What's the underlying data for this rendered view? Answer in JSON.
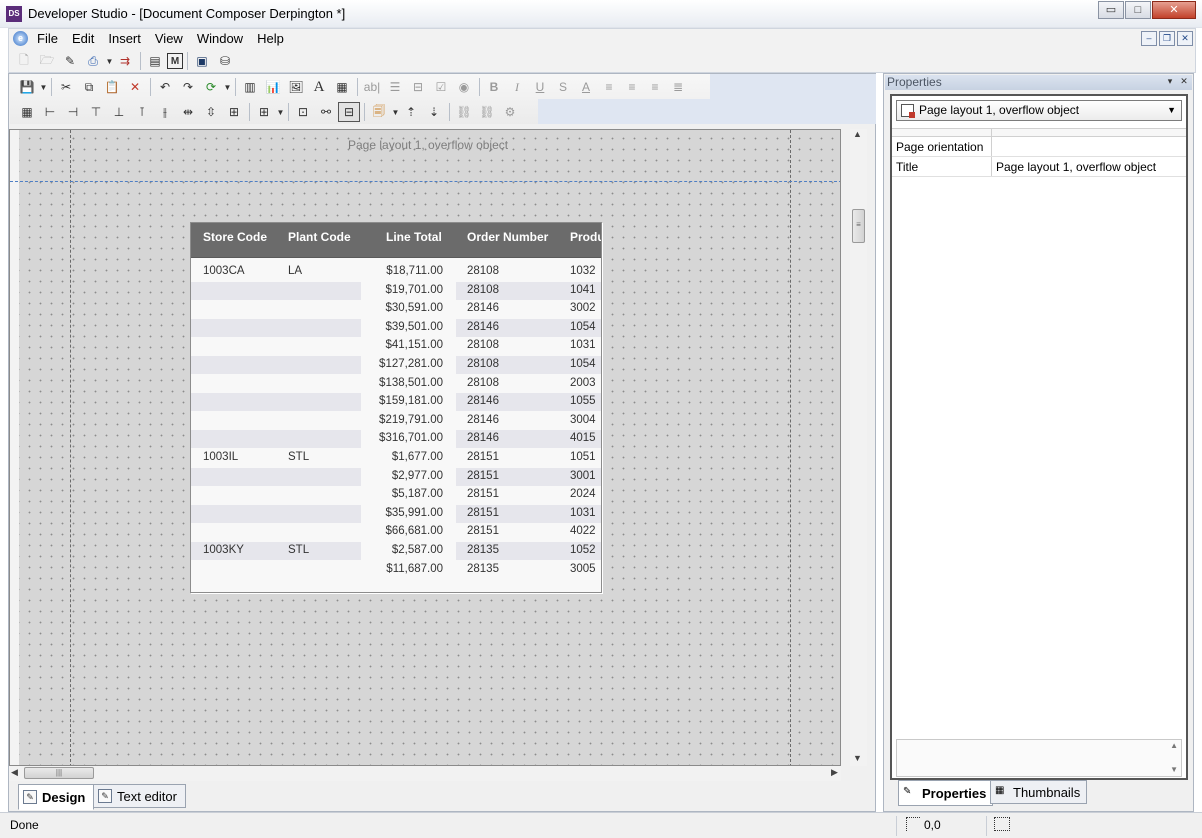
{
  "window": {
    "app_icon": "DS",
    "title": "Developer Studio - [Document Composer Derpington *]",
    "controls": {
      "minimize": "▭",
      "maximize": "□",
      "close": "✕"
    }
  },
  "menu": {
    "items": [
      "File",
      "Edit",
      "Insert",
      "View",
      "Window",
      "Help"
    ],
    "mdi_controls": {
      "minimize": "–",
      "restore": "❐",
      "close": "✕"
    }
  },
  "canvas": {
    "page_caption": "Page layout 1, overflow object"
  },
  "report_table": {
    "headers": [
      "Store Code",
      "Plant Code",
      "Line Total",
      "Order Number",
      "Produ"
    ],
    "rows": [
      [
        "1003CA",
        "LA",
        "$18,711.00",
        "28108",
        "1032"
      ],
      [
        "",
        "",
        "$19,701.00",
        "28108",
        "1041"
      ],
      [
        "",
        "",
        "$30,591.00",
        "28146",
        "3002"
      ],
      [
        "",
        "",
        "$39,501.00",
        "28146",
        "1054"
      ],
      [
        "",
        "",
        "$41,151.00",
        "28108",
        "1031"
      ],
      [
        "",
        "",
        "$127,281.00",
        "28108",
        "1054"
      ],
      [
        "",
        "",
        "$138,501.00",
        "28108",
        "2003"
      ],
      [
        "",
        "",
        "$159,181.00",
        "28146",
        "1055"
      ],
      [
        "",
        "",
        "$219,791.00",
        "28146",
        "3004"
      ],
      [
        "",
        "",
        "$316,701.00",
        "28146",
        "4015"
      ],
      [
        "1003IL",
        "STL",
        "$1,677.00",
        "28151",
        "1051"
      ],
      [
        "",
        "",
        "$2,977.00",
        "28151",
        "3001"
      ],
      [
        "",
        "",
        "$5,187.00",
        "28151",
        "2024"
      ],
      [
        "",
        "",
        "$35,991.00",
        "28151",
        "1031"
      ],
      [
        "",
        "",
        "$66,681.00",
        "28151",
        "4022"
      ],
      [
        "1003KY",
        "STL",
        "$2,587.00",
        "28135",
        "1052"
      ],
      [
        "",
        "",
        "$11,687.00",
        "28135",
        "3005"
      ]
    ]
  },
  "doc_tabs": {
    "design": "Design",
    "text_editor": "Text editor"
  },
  "properties": {
    "panel_title": "Properties",
    "selected_object": "Page layout 1, overflow object",
    "rows": [
      {
        "key": "Page orientation",
        "value": ""
      },
      {
        "key": "Title",
        "value": "Page layout 1, overflow object"
      }
    ],
    "tabs": {
      "properties": "Properties",
      "thumbnails": "Thumbnails"
    }
  },
  "status": {
    "text": "Done",
    "coordinates": "0,0"
  },
  "toolbar_text_format": {
    "bold": "B",
    "italic": "I",
    "underline": "U",
    "strike": "S",
    "font_color": "A"
  }
}
